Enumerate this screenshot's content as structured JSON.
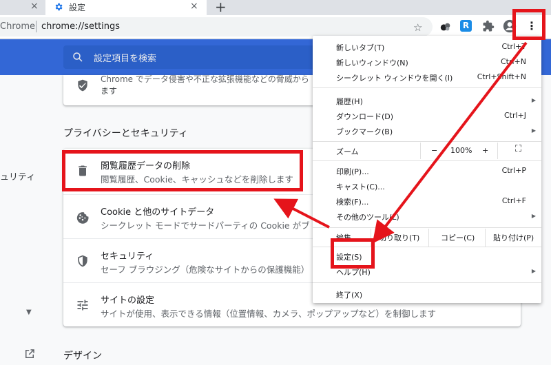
{
  "tabs": {
    "prev_close": "×",
    "active_title": "設定",
    "active_close": "×",
    "new_tab": "+"
  },
  "omnibox": {
    "scheme": "Chrome",
    "url": "chrome://settings"
  },
  "toolbar": {
    "star": "☆",
    "ext2_label": "R",
    "menu_dots": "⋮"
  },
  "search": {
    "placeholder": "設定項目を検索"
  },
  "nav": {
    "security_label": "ュリティ",
    "caret": "▼"
  },
  "top_card": {
    "line1": "Chrome でデータ侵害や不正な拡張機能などの脅威から",
    "line2": "ます"
  },
  "sections": {
    "privacy_title": "プライバシーとセキュリティ",
    "design_title": "デザイン"
  },
  "privacy_rows": [
    {
      "title": "閲覧履歴データの削除",
      "subtitle": "閲覧履歴、Cookie、キャッシュなどを削除します"
    },
    {
      "title": "Cookie と他のサイトデータ",
      "subtitle": "シークレット モードでサードパーティの Cookie がブ"
    },
    {
      "title": "セキュリティ",
      "subtitle": "セーフ ブラウジング（危険なサイトからの保護機能）"
    },
    {
      "title": "サイトの設定",
      "subtitle": "サイトが使用、表示できる情報（位置情報、カメラ、ポップアップなど）を制御します"
    }
  ],
  "menu": {
    "new_tab": "新しいタブ(T)",
    "new_tab_sc": "Ctrl+T",
    "new_window": "新しいウィンドウ(N)",
    "new_window_sc": "Ctrl+N",
    "incognito": "シークレット ウィンドウを開く(I)",
    "incognito_sc": "Ctrl+Shift+N",
    "history": "履歴(H)",
    "downloads": "ダウンロード(D)",
    "downloads_sc": "Ctrl+J",
    "bookmarks": "ブックマーク(B)",
    "zoom": "ズーム",
    "zoom_minus": "−",
    "zoom_value": "100%",
    "zoom_plus": "+",
    "fullscreen": "⛶",
    "print": "印刷(P)...",
    "print_sc": "Ctrl+P",
    "cast": "キャスト(C)...",
    "find": "検索(F)...",
    "find_sc": "Ctrl+F",
    "more_tools": "その他のツール(L)",
    "edit": "編集",
    "cut": "切り取り(T)",
    "copy": "コピー(C)",
    "paste": "貼り付け(P)",
    "settings": "設定(S)",
    "help": "ヘルプ(H)",
    "exit": "終了(X)",
    "arrow": "▶"
  },
  "colors": {
    "highlight": "#e5141b",
    "header_blue": "#3367d6"
  }
}
